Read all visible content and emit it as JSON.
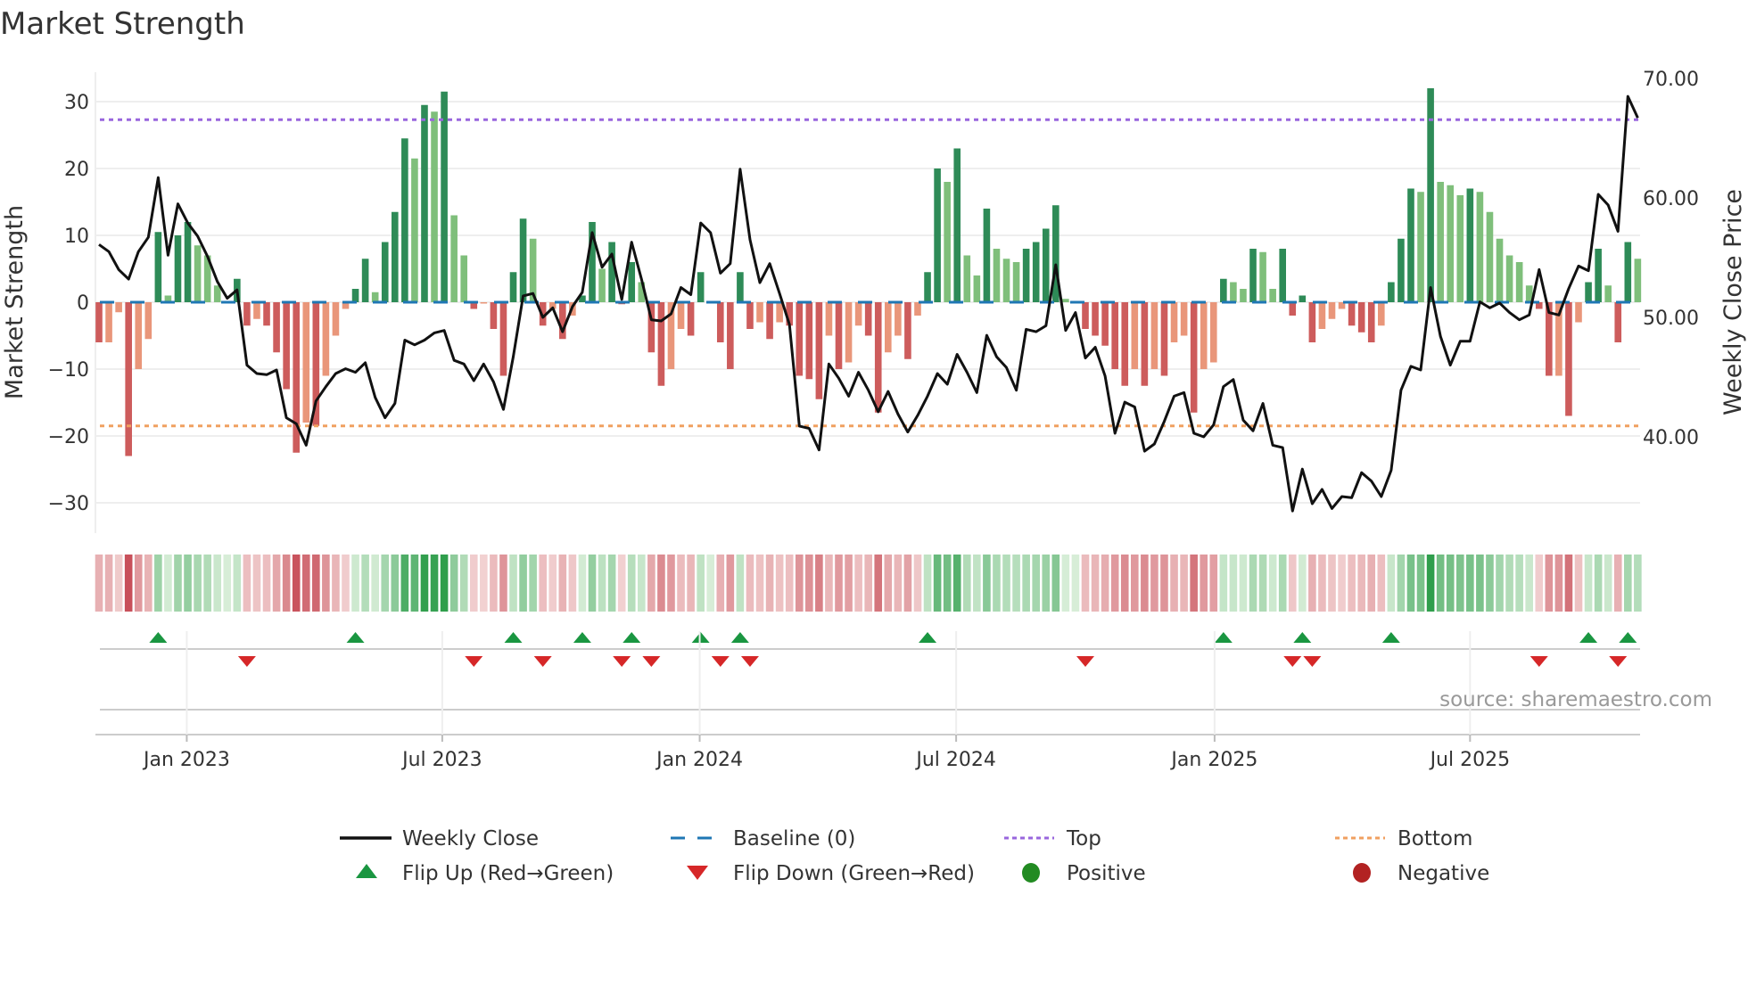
{
  "chart_data": {
    "type": "bar",
    "title": "Market Strength",
    "ylabel": "Market Strength",
    "y2label": "Weekly Close Price",
    "ylim": [
      -34,
      34
    ],
    "y2lim": [
      32.4,
      71.2
    ],
    "yticks": [
      30,
      20,
      10,
      0,
      -10,
      -20,
      -30
    ],
    "yticklabels": [
      "30",
      "20",
      "10",
      "0",
      "−10",
      "−20",
      "−30"
    ],
    "y2ticks": [
      70,
      60,
      50,
      40
    ],
    "y2ticklabels": [
      "70.00",
      "60.00",
      "50.00",
      "40.00"
    ],
    "x_unit": "week index",
    "xticks": [
      {
        "week": 8.9,
        "label": "Jan 2023"
      },
      {
        "week": 34.8,
        "label": "Jul 2023"
      },
      {
        "week": 60.9,
        "label": "Jan 2024"
      },
      {
        "week": 86.9,
        "label": "Jul 2024"
      },
      {
        "week": 113.1,
        "label": "Jan 2025"
      },
      {
        "week": 139.0,
        "label": "Jul 2025"
      }
    ],
    "top_level": 27.3,
    "bottom_level": -18.5,
    "baseline": 0,
    "strength": [
      -6,
      -6,
      -1.5,
      -23,
      -10,
      -5.5,
      10.5,
      1,
      10,
      12,
      8.5,
      7,
      2.5,
      0.2,
      3.5,
      -3.5,
      -2.5,
      -3.5,
      -7.5,
      -13,
      -22.5,
      -18,
      -18.5,
      -11,
      -5,
      -1,
      2,
      6.5,
      1.5,
      9,
      13.5,
      24.5,
      21.5,
      29.5,
      28.5,
      31.5,
      13,
      7,
      -1,
      -0.2,
      -4,
      -11,
      4.5,
      12.5,
      9.5,
      -3.5,
      -1,
      -5.5,
      -2,
      1,
      12,
      5,
      9,
      -0.3,
      6,
      3,
      -7.5,
      -12.5,
      -10,
      -4,
      -5,
      4.5,
      0.2,
      -6,
      -10,
      4.5,
      -4,
      -3,
      -5.5,
      -3,
      -3.5,
      -11,
      -11.5,
      -14.5,
      -5,
      -10,
      -9,
      -3.5,
      -5,
      -16.5,
      -7.5,
      -5,
      -8.5,
      -2,
      4.5,
      20,
      18,
      23,
      7,
      4,
      14,
      8,
      6.5,
      6,
      8,
      9,
      11,
      14.5,
      0.5,
      0.2,
      -4,
      -5,
      -6.5,
      -10,
      -12.5,
      -10,
      -12.5,
      -10,
      -11,
      -6,
      -5,
      -16.5,
      -10,
      -9,
      3.5,
      3,
      2,
      8,
      7.5,
      2,
      8,
      -2,
      1,
      -6,
      -4,
      -2.5,
      -1,
      -3.5,
      -4.5,
      -6,
      -3.5,
      3,
      9.5,
      17,
      16.5,
      32,
      18,
      17.5,
      16,
      17,
      16.5,
      13.5,
      9.5,
      7,
      6,
      2.5,
      -1,
      -11,
      -11,
      -17,
      -3,
      3,
      8,
      2.5,
      -6,
      9,
      6.5
    ],
    "weekly_close": [
      56.1,
      55.5,
      54.0,
      53.2,
      55.5,
      56.7,
      61.7,
      55.2,
      59.5,
      57.9,
      56.8,
      55.1,
      53.0,
      51.6,
      52.3,
      46.0,
      45.3,
      45.2,
      45.6,
      41.6,
      41.1,
      39.3,
      43.0,
      44.2,
      45.3,
      45.7,
      45.4,
      46.2,
      43.3,
      41.6,
      42.8,
      48.1,
      47.7,
      48.1,
      48.7,
      48.9,
      46.4,
      46.1,
      44.7,
      46.1,
      44.6,
      42.3,
      46.7,
      51.8,
      52.0,
      50.0,
      50.8,
      48.8,
      50.9,
      52.1,
      57.1,
      54.2,
      55.3,
      51.5,
      56.3,
      53.2,
      49.8,
      49.7,
      50.3,
      52.5,
      51.9,
      57.9,
      57.1,
      53.7,
      54.5,
      62.4,
      56.5,
      52.9,
      54.5,
      52.0,
      49.4,
      40.9,
      40.7,
      38.9,
      46.1,
      44.9,
      43.4,
      45.4,
      43.9,
      42.1,
      43.8,
      41.9,
      40.4,
      41.8,
      43.4,
      45.3,
      44.4,
      46.9,
      45.4,
      43.7,
      48.5,
      46.7,
      45.8,
      43.9,
      49.0,
      48.8,
      49.3,
      54.4,
      48.9,
      50.4,
      46.6,
      47.5,
      45.1,
      40.3,
      42.9,
      42.5,
      38.8,
      39.4,
      41.3,
      43.4,
      43.7,
      40.3,
      40.0,
      41.0,
      44.2,
      44.8,
      41.4,
      40.5,
      42.8,
      39.3,
      39.1,
      33.8,
      37.3,
      34.4,
      35.6,
      34.0,
      35.0,
      34.9,
      37.0,
      36.3,
      35.0,
      37.2,
      43.9,
      45.9,
      45.6,
      52.5,
      48.4,
      46.0,
      48.0,
      48.0,
      51.3,
      50.8,
      51.2,
      50.4,
      49.8,
      50.2,
      54.0,
      50.4,
      50.2,
      52.4,
      54.3,
      53.9,
      60.3,
      59.4,
      57.2,
      68.5,
      66.7
    ],
    "legend": {
      "placement": "bottom",
      "items": [
        {
          "label": "Weekly Close",
          "kind": "line"
        },
        {
          "label": "Baseline (0)",
          "kind": "dash"
        },
        {
          "label": "Top",
          "kind": "dot"
        },
        {
          "label": "Bottom",
          "kind": "dot"
        },
        {
          "label": "Flip Up (Red→Green)",
          "kind": "up"
        },
        {
          "label": "Flip Down (Green→Red)",
          "kind": "down"
        },
        {
          "label": "Positive",
          "kind": "circle"
        },
        {
          "label": "Negative",
          "kind": "circle"
        }
      ]
    },
    "source": "source: sharemaestro.com",
    "colors": {
      "pos_strong": "#2e8b57",
      "pos_weak": "#7fbf7b",
      "neg_strong": "#cd5c5c",
      "neg_weak": "#e9967a",
      "close": "#111111",
      "baseline": "#1f77b4",
      "top": "#9966dd",
      "bottom": "#f0a060",
      "flip_up": "#1a9641",
      "flip_down": "#d62728",
      "positive": "#228b22",
      "negative": "#b22222"
    }
  }
}
